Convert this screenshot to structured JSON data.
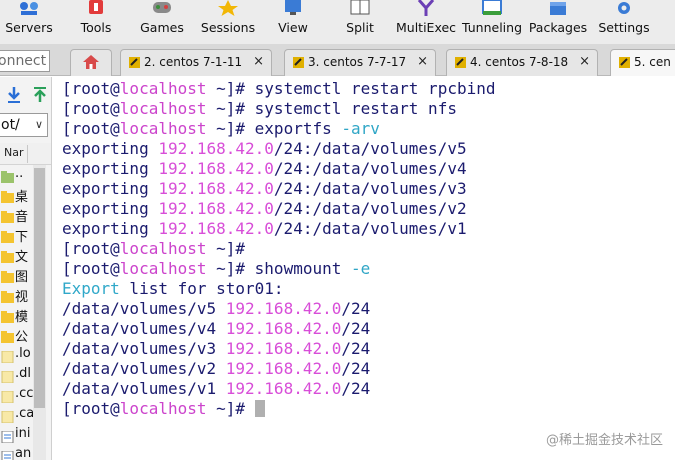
{
  "toolbar": {
    "items": [
      {
        "label": "Servers",
        "icon": "servers-icon"
      },
      {
        "label": "Tools",
        "icon": "tools-icon"
      },
      {
        "label": "Games",
        "icon": "games-icon"
      },
      {
        "label": "Sessions",
        "icon": "sessions-icon"
      },
      {
        "label": "View",
        "icon": "view-icon"
      },
      {
        "label": "Split",
        "icon": "split-icon"
      },
      {
        "label": "MultiExec",
        "icon": "multiexec-icon"
      },
      {
        "label": "Tunneling",
        "icon": "tunneling-icon"
      },
      {
        "label": "Packages",
        "icon": "packages-icon"
      },
      {
        "label": "Settings",
        "icon": "settings-icon"
      }
    ]
  },
  "quick_connect": {
    "value": "onnect"
  },
  "tabs": [
    {
      "label": "2. centos 7-1-11",
      "close": "×"
    },
    {
      "label": "3. centos 7-7-17",
      "close": "×"
    },
    {
      "label": "4. centos 7-8-18",
      "close": "×"
    },
    {
      "label": "5. cen",
      "close": ""
    }
  ],
  "sidebar": {
    "path": "ot/",
    "path_chevron": "∨",
    "column_header": "Nar",
    "files": [
      {
        "name": "..",
        "icon": "parent-folder-icon"
      },
      {
        "name": "桌",
        "icon": "folder-icon"
      },
      {
        "name": "音",
        "icon": "folder-icon"
      },
      {
        "name": "下",
        "icon": "folder-icon"
      },
      {
        "name": "文",
        "icon": "folder-icon"
      },
      {
        "name": "图",
        "icon": "folder-icon"
      },
      {
        "name": "视",
        "icon": "folder-icon"
      },
      {
        "name": "模",
        "icon": "folder-icon"
      },
      {
        "name": "公",
        "icon": "folder-icon"
      },
      {
        "name": ".lo",
        "icon": "file-icon"
      },
      {
        "name": ".dl",
        "icon": "file-icon"
      },
      {
        "name": ".cc",
        "icon": "file-icon"
      },
      {
        "name": ".ca",
        "icon": "file-icon"
      },
      {
        "name": "ini",
        "icon": "doc-file-icon"
      },
      {
        "name": "an",
        "icon": "doc-file-icon"
      }
    ]
  },
  "terminal": {
    "lines": [
      [
        {
          "t": "[root@",
          "c": "default"
        },
        {
          "t": "localhost",
          "c": "host"
        },
        {
          "t": " ~]# systemctl restart rpcbind",
          "c": "default"
        }
      ],
      [
        {
          "t": "[root@",
          "c": "default"
        },
        {
          "t": "localhost",
          "c": "host"
        },
        {
          "t": " ~]# systemctl restart nfs",
          "c": "default"
        }
      ],
      [
        {
          "t": "[root@",
          "c": "default"
        },
        {
          "t": "localhost",
          "c": "host"
        },
        {
          "t": " ~]# exportfs ",
          "c": "default"
        },
        {
          "t": "-arv",
          "c": "opt"
        }
      ],
      [
        {
          "t": "exporting ",
          "c": "default"
        },
        {
          "t": "192.168.42.0",
          "c": "ip"
        },
        {
          "t": "/24:/data/volumes/v5",
          "c": "default"
        }
      ],
      [
        {
          "t": "exporting ",
          "c": "default"
        },
        {
          "t": "192.168.42.0",
          "c": "ip"
        },
        {
          "t": "/24:/data/volumes/v4",
          "c": "default"
        }
      ],
      [
        {
          "t": "exporting ",
          "c": "default"
        },
        {
          "t": "192.168.42.0",
          "c": "ip"
        },
        {
          "t": "/24:/data/volumes/v3",
          "c": "default"
        }
      ],
      [
        {
          "t": "exporting ",
          "c": "default"
        },
        {
          "t": "192.168.42.0",
          "c": "ip"
        },
        {
          "t": "/24:/data/volumes/v2",
          "c": "default"
        }
      ],
      [
        {
          "t": "exporting ",
          "c": "default"
        },
        {
          "t": "192.168.42.0",
          "c": "ip"
        },
        {
          "t": "/24:/data/volumes/v1",
          "c": "default"
        }
      ],
      [
        {
          "t": "[root@",
          "c": "default"
        },
        {
          "t": "localhost",
          "c": "host"
        },
        {
          "t": " ~]#",
          "c": "default"
        }
      ],
      [
        {
          "t": "[root@",
          "c": "default"
        },
        {
          "t": "localhost",
          "c": "host"
        },
        {
          "t": " ~]# showmount ",
          "c": "default"
        },
        {
          "t": "-e",
          "c": "opt"
        }
      ],
      [
        {
          "t": "Export",
          "c": "cyan"
        },
        {
          "t": " list for stor01:",
          "c": "default"
        }
      ],
      [
        {
          "t": "/data/volumes/v5 ",
          "c": "default"
        },
        {
          "t": "192.168.42.0",
          "c": "ip"
        },
        {
          "t": "/24",
          "c": "default"
        }
      ],
      [
        {
          "t": "/data/volumes/v4 ",
          "c": "default"
        },
        {
          "t": "192.168.42.0",
          "c": "ip"
        },
        {
          "t": "/24",
          "c": "default"
        }
      ],
      [
        {
          "t": "/data/volumes/v3 ",
          "c": "default"
        },
        {
          "t": "192.168.42.0",
          "c": "ip"
        },
        {
          "t": "/24",
          "c": "default"
        }
      ],
      [
        {
          "t": "/data/volumes/v2 ",
          "c": "default"
        },
        {
          "t": "192.168.42.0",
          "c": "ip"
        },
        {
          "t": "/24",
          "c": "default"
        }
      ],
      [
        {
          "t": "/data/volumes/v1 ",
          "c": "default"
        },
        {
          "t": "192.168.42.0",
          "c": "ip"
        },
        {
          "t": "/24",
          "c": "default"
        }
      ],
      [
        {
          "t": "[root@",
          "c": "default"
        },
        {
          "t": "localhost",
          "c": "host"
        },
        {
          "t": " ~]# ",
          "c": "default"
        }
      ]
    ],
    "cursor_line": 16
  },
  "watermark": "@稀土掘金技术社区",
  "colors": {
    "default_text": "#1b1b6e",
    "hostname": "#cc44cc",
    "ip": "#d84ed8",
    "option": "#2fa6c6"
  }
}
